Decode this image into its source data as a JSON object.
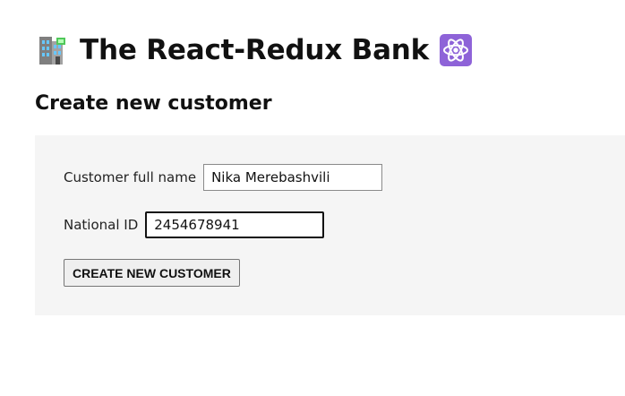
{
  "header": {
    "title": "The React-Redux Bank",
    "leading_icon": "bank-building-icon",
    "trailing_icon": "react-atom-icon"
  },
  "section": {
    "heading": "Create new customer"
  },
  "form": {
    "full_name_label": "Customer full name",
    "full_name_value": "Nika Merebashvili",
    "national_id_label": "National ID",
    "national_id_value": "2454678941",
    "submit_label": "CREATE NEW CUSTOMER"
  },
  "colors": {
    "panel_bg": "#f5f5f5",
    "atom_bg": "#8e63d8",
    "building": "#8f8f8f"
  }
}
